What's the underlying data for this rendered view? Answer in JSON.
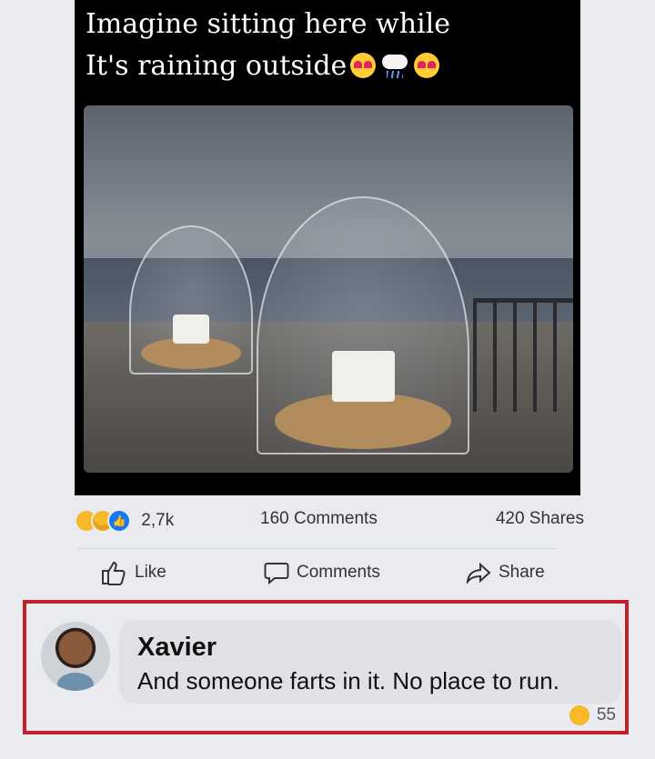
{
  "post": {
    "caption_line1": "Imagine sitting here while",
    "caption_line2": "It's raining outside",
    "caption_emojis": [
      "heart-eyes",
      "cloud-with-rain",
      "heart-eyes"
    ]
  },
  "engagement": {
    "reactions": [
      "haha",
      "wow",
      "like"
    ],
    "reaction_count": "2,7k",
    "comments_count": "160 Comments",
    "shares_count": "420 Shares"
  },
  "actions": {
    "like": "Like",
    "comments": "Comments",
    "share": "Share"
  },
  "comment": {
    "author": "Xavier",
    "text": "And someone farts in it. No place to run.",
    "reaction": "haha",
    "reaction_count": "55"
  },
  "colors": {
    "highlight_border": "#c0202a",
    "like_blue": "#1877f2",
    "reaction_yellow": "#f7b928"
  }
}
